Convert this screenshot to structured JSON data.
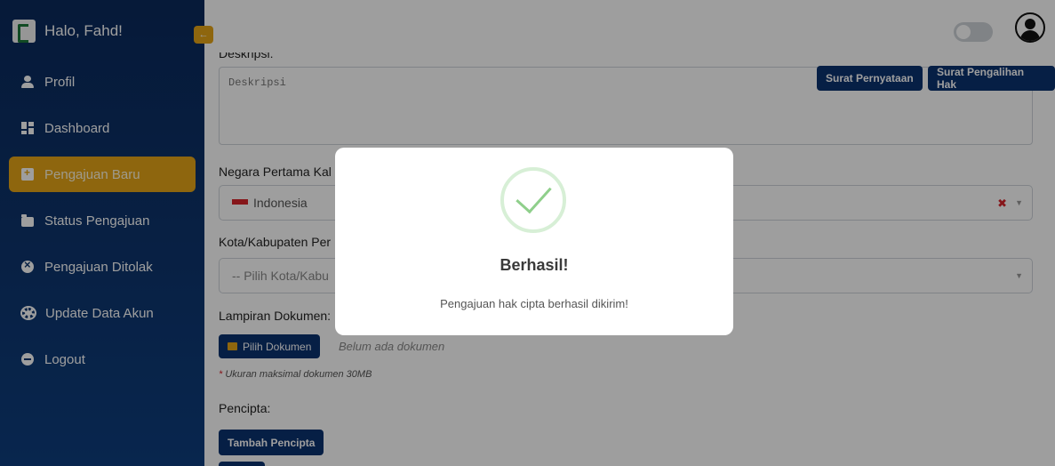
{
  "sidebar": {
    "greeting": "Halo, Fahd!",
    "items": [
      {
        "label": "Profil",
        "icon": "user-icon"
      },
      {
        "label": "Dashboard",
        "icon": "dashboard-icon"
      },
      {
        "label": "Pengajuan Baru",
        "icon": "file-plus-icon",
        "active": true
      },
      {
        "label": "Status Pengajuan",
        "icon": "folder-icon"
      },
      {
        "label": "Pengajuan Ditolak",
        "icon": "x-circle-icon"
      },
      {
        "label": "Update Data Akun",
        "icon": "gear-icon"
      },
      {
        "label": "Logout",
        "icon": "logout-icon"
      }
    ],
    "accent": "#e6a517",
    "background": "#0d3670"
  },
  "header": {
    "collapse_icon": "arrow-left-icon"
  },
  "form": {
    "deskripsi_label": "Deskripsi:",
    "deskripsi_placeholder": "Deskripsi",
    "surat_pernyataan": "Surat Pernyataan",
    "surat_pengalihan": "Surat Pengalihan Hak",
    "negara_label": "Negara Pertama Kal",
    "negara_value": "Indonesia",
    "kota_label": "Kota/Kabupaten Per",
    "kota_placeholder": "-- Pilih Kota/Kabu",
    "lampiran_label": "Lampiran Dokumen:",
    "pilih_dokumen": "Pilih Dokumen",
    "belum_ada": "Belum ada dokumen",
    "ukuran_note": "Ukuran maksimal dokumen 30MB",
    "pencipta_label": "Pencipta:",
    "tambah_pencipta": "Tambah Pencipta"
  },
  "modal": {
    "title": "Berhasil!",
    "message": "Pengajuan hak cipta berhasil dikirim!",
    "icon": "check-icon"
  }
}
